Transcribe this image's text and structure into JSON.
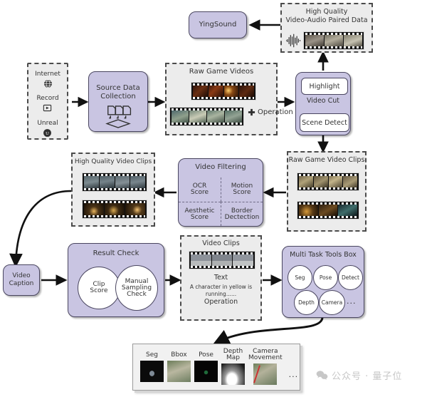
{
  "diagram": {
    "title": "Game video data processing pipeline",
    "colors": {
      "process_fill": "#c9c5e2",
      "process_stroke": "#4a4660",
      "container_fill": "#ececec",
      "container_stroke": "#4b4b4b",
      "arrow": "#111111",
      "watermark": "#c7c7c7"
    }
  },
  "sources": {
    "items": [
      {
        "label": "Internet",
        "icon": "globe-icon"
      },
      {
        "label": "Record",
        "icon": "screen-record-icon"
      },
      {
        "label": "Unreal",
        "icon": "unreal-engine-icon"
      }
    ]
  },
  "source_collection": {
    "title": "Source Data\nCollection",
    "line1": "Source Data",
    "line2": "Collection",
    "icon": "documents-collect-icon"
  },
  "raw_game_videos": {
    "title": "Raw Game Videos",
    "operation_label": "Operation",
    "operation_icon": "dpad-cross-icon"
  },
  "video_cut": {
    "title": "Video Cut",
    "top_label": "Highlight",
    "bottom_label": "Scene Detect"
  },
  "high_quality_pair": {
    "line1": "High Quality",
    "line2": "Video-Audio Paired Data",
    "icon": "audio-waveform-icon"
  },
  "yingsound": {
    "label": "YingSound"
  },
  "raw_game_video_clips": {
    "title": "Raw Game Video Clips"
  },
  "video_filtering": {
    "title": "Video Filtering",
    "cells": [
      {
        "line1": "OCR",
        "line2": "Score"
      },
      {
        "line1": "Motion",
        "line2": "Score"
      },
      {
        "line1": "Aesthetic",
        "line2": "Score"
      },
      {
        "line1": "Border",
        "line2": "Dectection"
      }
    ]
  },
  "high_quality_clips": {
    "title": "High Quality Video Clips"
  },
  "video_caption": {
    "line1": "Video",
    "line2": "Caption"
  },
  "result_check": {
    "title": "Result Check",
    "circles": [
      {
        "lines": [
          "Clip",
          "Score"
        ]
      },
      {
        "lines": [
          "Manual",
          "Sampling",
          "Check"
        ]
      }
    ]
  },
  "video_clips": {
    "title": "Video Clips",
    "text_label": "Text",
    "caption_line1": "A character in yellow  is",
    "caption_line2": "running......",
    "operation_label": "Operation"
  },
  "tools_box": {
    "title": "Multi Task Tools Box",
    "row1": [
      "Seg",
      "Pose",
      "Detect"
    ],
    "row2": [
      "Depth",
      "Camera"
    ],
    "ellipsis": "..."
  },
  "outputs": {
    "columns": [
      {
        "line1": "Seg",
        "line2": ""
      },
      {
        "line1": "Bbox",
        "line2": ""
      },
      {
        "line1": "Pose",
        "line2": ""
      },
      {
        "line1": "Depth",
        "line2": "Map"
      },
      {
        "line1": "Camera",
        "line2": "Movement"
      }
    ],
    "ellipsis": "..."
  },
  "watermark": {
    "text": "公众号 · 量子位",
    "icon": "wechat-icon"
  }
}
